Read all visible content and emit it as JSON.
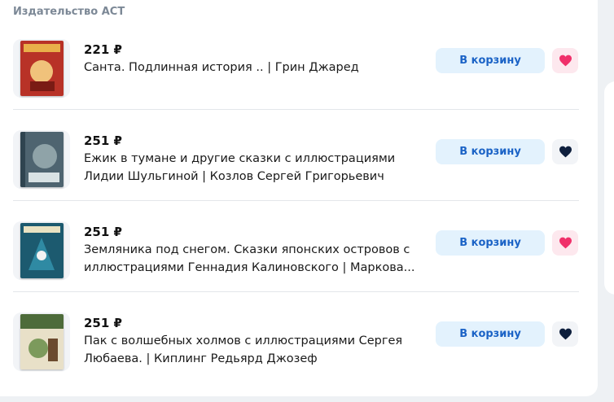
{
  "publisher": "Издательство АСТ",
  "colors": {
    "cart_bg": "#e3f2fd",
    "cart_text": "#1b63c6",
    "heart_active": "#f0306a",
    "heart_inactive": "#0e1f3d"
  },
  "items": [
    {
      "price": "221 ₽",
      "title": "Санта. Подлинная история .. | Грин Джаред",
      "cart_label": "В корзину",
      "favorite": true,
      "cover_color": "#c0392b"
    },
    {
      "price": "251 ₽",
      "title": "Ежик в тумане и другие сказки с иллюстрациями Лидии Шульгиной | Козлов Сергей Григорьевич",
      "cart_label": "В корзину",
      "favorite": false,
      "cover_color": "#5a6f79"
    },
    {
      "price": "251 ₽",
      "title": "Земляника под снегом. Сказки японских островов с иллюстрациями Геннадия Калиновского | Маркова...",
      "cart_label": "В корзину",
      "favorite": true,
      "cover_color": "#1f5f74"
    },
    {
      "price": "251 ₽",
      "title": "Пак с волшебных холмов с иллюстрациями Сергея Любаева. | Киплинг Редьярд Джозеф",
      "cart_label": "В корзину",
      "favorite": false,
      "cover_color": "#4d6b3a"
    }
  ]
}
